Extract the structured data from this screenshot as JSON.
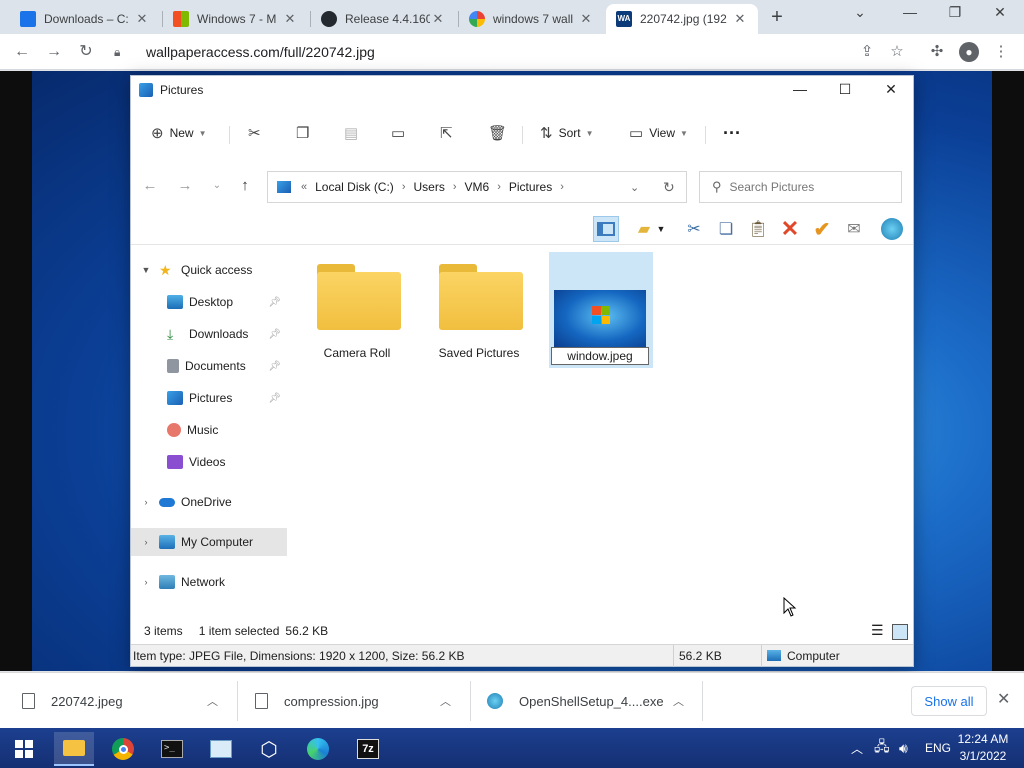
{
  "browser": {
    "tabs": [
      {
        "title": "Downloads – C:",
        "favicon_color": "#1a73e8"
      },
      {
        "title": "Windows 7 - M",
        "favicon_color": "#f25022"
      },
      {
        "title": "Release 4.4.160",
        "favicon_color": "#24292f"
      },
      {
        "title": "windows 7 wall",
        "favicon_color": "#4285f4"
      },
      {
        "title": "220742.jpg (192",
        "favicon_color": "#0b3b78"
      }
    ],
    "url": "wallpaperaccess.com/full/220742.jpg",
    "favicon_text": "WA"
  },
  "explorer": {
    "title": "Pictures",
    "commands": {
      "new": "New",
      "sort": "Sort",
      "view": "View"
    },
    "address": [
      "Local Disk (C:)",
      "Users",
      "VM6",
      "Pictures"
    ],
    "search_placeholder": "Search Pictures",
    "nav": {
      "quick_access": "Quick access",
      "desktop": "Desktop",
      "downloads": "Downloads",
      "documents": "Documents",
      "pictures": "Pictures",
      "music": "Music",
      "videos": "Videos",
      "onedrive": "OneDrive",
      "my_computer": "My Computer",
      "network": "Network"
    },
    "items": {
      "camera_roll": "Camera Roll",
      "saved_pictures": "Saved Pictures",
      "rename_value": "window.jpeg"
    },
    "status": {
      "count": "3 items",
      "selected": "1 item selected",
      "size": "56.2 KB"
    },
    "details": {
      "info": "Item type: JPEG File, Dimensions: 1920 x 1200, Size: 56.2 KB",
      "size": "56.2 KB",
      "location": "Computer"
    }
  },
  "downloads": {
    "items": [
      "220742.jpeg",
      "compression.jpg",
      "OpenShellSetup_4....exe"
    ],
    "show_all": "Show all"
  },
  "taskbar": {
    "language": "ENG",
    "time": "12:24 AM",
    "date": "3/1/2022"
  }
}
